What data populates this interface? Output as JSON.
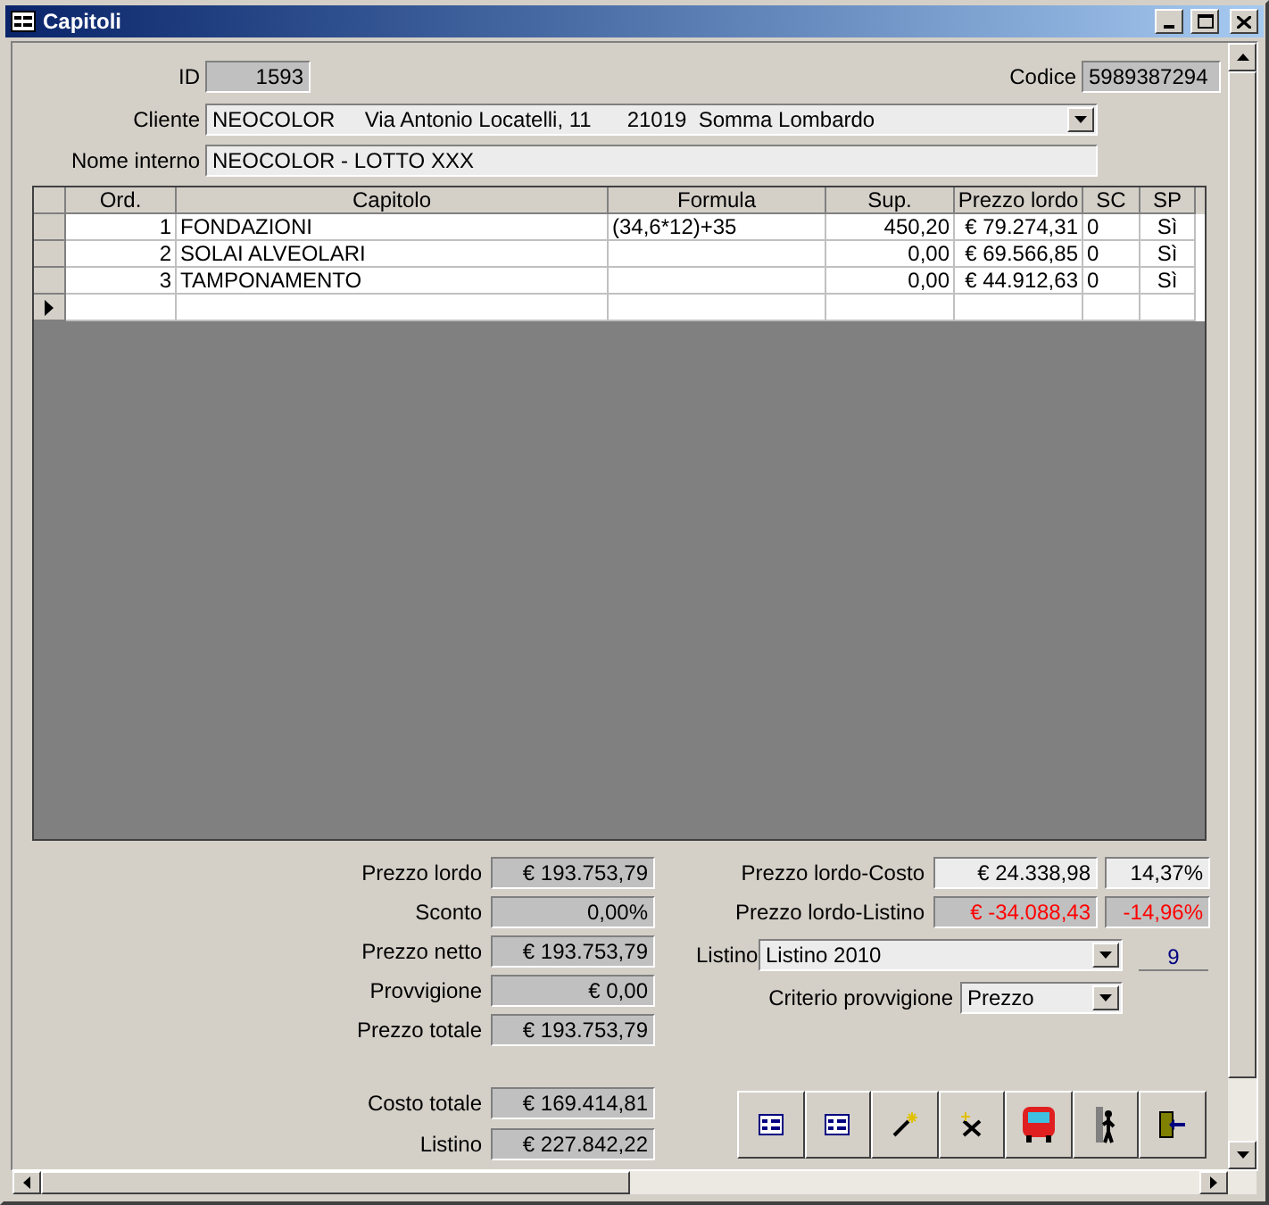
{
  "window": {
    "title": "Capitoli"
  },
  "header": {
    "id_label": "ID",
    "id_value": "1593",
    "codice_label": "Codice",
    "codice_value": "5989387294",
    "cliente_label": "Cliente",
    "cliente_value": "NEOCOLOR     Via Antonio Locatelli, 11      21019  Somma Lombardo",
    "nome_label": "Nome interno",
    "nome_value": "NEOCOLOR - LOTTO XXX"
  },
  "table": {
    "columns": [
      "Ord.",
      "Capitolo",
      "Formula",
      "Sup.",
      "Prezzo lordo",
      "SC",
      "SP"
    ],
    "rows": [
      {
        "cells": [
          "1",
          "FONDAZIONI",
          "(34,6*12)+35",
          "450,20",
          "€ 79.274,31",
          "0",
          "Sì"
        ],
        "selected": false
      },
      {
        "cells": [
          "2",
          "SOLAI ALVEOLARI",
          "",
          "0,00",
          "€ 69.566,85",
          "0",
          "Sì"
        ],
        "selected": false
      },
      {
        "cells": [
          "3",
          "TAMPONAMENTO",
          "",
          "0,00",
          "€ 44.912,63",
          "0",
          "Sì"
        ],
        "selected": false
      }
    ],
    "new_row": {
      "selected": true
    }
  },
  "totals": [
    {
      "label": "Prezzo lordo",
      "value": "€ 193.753,79"
    },
    {
      "label": "Sconto",
      "value": "0,00%"
    },
    {
      "label": "Prezzo netto",
      "value": "€ 193.753,79"
    },
    {
      "label": "Provvigione",
      "value": "€ 0,00"
    },
    {
      "label": "Prezzo totale",
      "value": "€ 193.753,79"
    }
  ],
  "costs": [
    {
      "label": "Costo totale",
      "value": "€ 169.414,81"
    },
    {
      "label": "Listino",
      "value": "€ 227.842,22"
    }
  ],
  "margins": [
    {
      "label": "Prezzo lordo-Costo",
      "value": "€ 24.338,98",
      "percent": "14,37%",
      "negative": false
    },
    {
      "label": "Prezzo lordo-Listino",
      "value": "€ -34.088,43",
      "percent": "-14,96%",
      "negative": true
    }
  ],
  "listino": {
    "label": "Listino",
    "value": "Listino 2010",
    "number": "9"
  },
  "criterio": {
    "label": "Criterio provvigione",
    "value": "Prezzo"
  },
  "buttons": [
    {
      "kind": "form"
    },
    {
      "kind": "form"
    },
    {
      "kind": "wand"
    },
    {
      "kind": "wand-cross"
    },
    {
      "kind": "bus"
    },
    {
      "kind": "person"
    },
    {
      "kind": "exit"
    }
  ]
}
